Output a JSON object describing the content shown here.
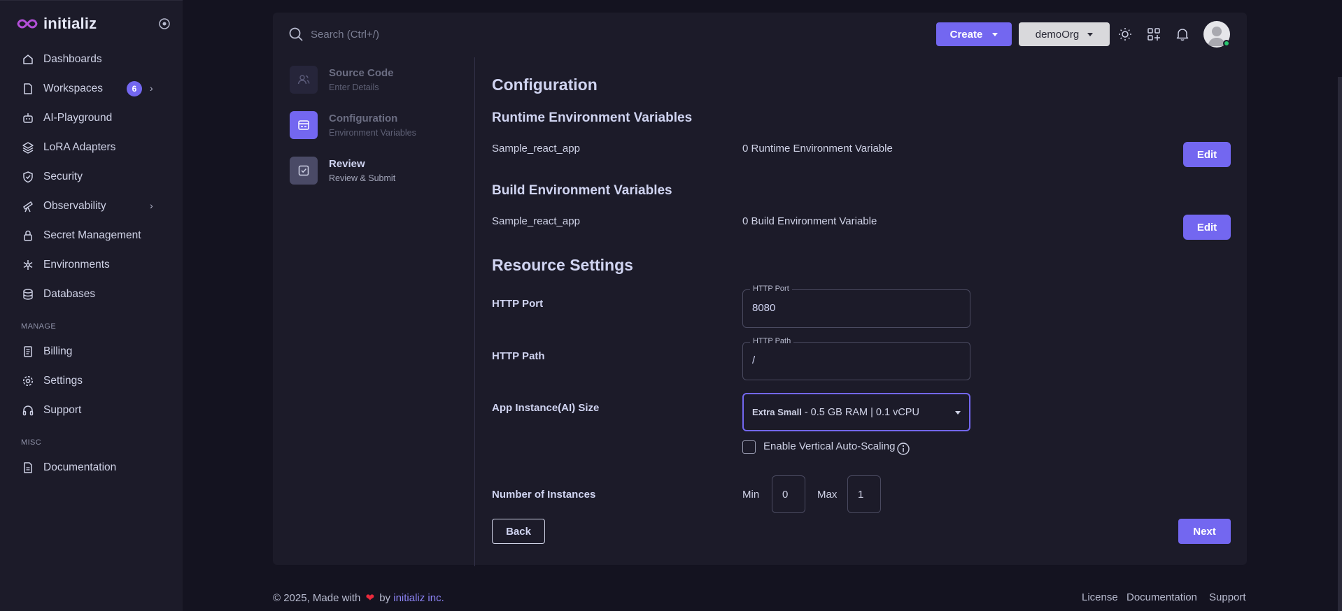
{
  "brand": {
    "name": "initializ"
  },
  "sidebar": {
    "items": [
      {
        "label": "Dashboards",
        "icon": "home-icon"
      },
      {
        "label": "Workspaces",
        "icon": "file-icon",
        "badge": "6"
      },
      {
        "label": "AI-Playground",
        "icon": "robot-icon"
      },
      {
        "label": "LoRA Adapters",
        "icon": "layers-icon"
      },
      {
        "label": "Security",
        "icon": "shield-icon"
      },
      {
        "label": "Observability",
        "icon": "telescope-icon"
      },
      {
        "label": "Secret Management",
        "icon": "lock-icon"
      },
      {
        "label": "Environments",
        "icon": "snowflake-icon"
      },
      {
        "label": "Databases",
        "icon": "database-icon"
      }
    ],
    "manage_label": "MANAGE",
    "manage_items": [
      {
        "label": "Billing",
        "icon": "receipt-icon"
      },
      {
        "label": "Settings",
        "icon": "gear-icon"
      },
      {
        "label": "Support",
        "icon": "headphones-icon"
      }
    ],
    "misc_label": "MISC",
    "misc_items": [
      {
        "label": "Documentation",
        "icon": "document-icon"
      }
    ]
  },
  "header": {
    "search_placeholder": "Search (Ctrl+/)",
    "create_label": "Create",
    "org_label": "demoOrg"
  },
  "stepper": [
    {
      "title": "Source Code",
      "subtitle": "Enter Details",
      "state": "done"
    },
    {
      "title": "Configuration",
      "subtitle": "Environment Variables",
      "state": "active"
    },
    {
      "title": "Review",
      "subtitle": "Review & Submit",
      "state": "pending"
    }
  ],
  "main": {
    "title": "Configuration",
    "runtime": {
      "heading": "Runtime Environment Variables",
      "app": "Sample_react_app",
      "count_text": "0 Runtime Environment Variable",
      "edit_label": "Edit"
    },
    "build": {
      "heading": "Build Environment Variables",
      "app": "Sample_react_app",
      "count_text": "0 Build Environment Variable",
      "edit_label": "Edit"
    },
    "resources": {
      "heading": "Resource Settings",
      "http_port_label": "HTTP Port",
      "http_port_legend": "HTTP Port",
      "http_port_value": "8080",
      "http_path_label": "HTTP Path",
      "http_path_legend": "HTTP Path",
      "http_path_value": "/",
      "size_label": "App Instance(AI) Size",
      "size_bold": "Extra Small",
      "size_detail": "- 0.5 GB RAM | 0.1 vCPU",
      "autoscale_label": "Enable Vertical Auto-Scaling",
      "autoscale_checked": false,
      "instances_label": "Number of Instances",
      "min_label": "Min",
      "min_value": "0",
      "max_label": "Max",
      "max_value": "1"
    },
    "back_label": "Back",
    "next_label": "Next"
  },
  "footer": {
    "copyright": "© 2025, Made with",
    "by": "by",
    "company": "initializ inc.",
    "links": [
      "License",
      "Documentation",
      "Support"
    ]
  },
  "colors": {
    "accent": "#7367f0",
    "background": "#141320",
    "card": "#1c1b29",
    "online": "#28c76f",
    "heart": "#ea2a3c"
  }
}
